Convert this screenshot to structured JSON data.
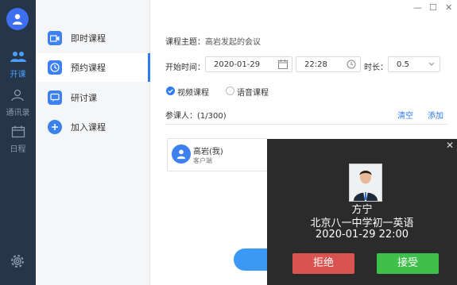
{
  "rail": {
    "items": [
      {
        "label": "开课",
        "icon": "people-icon"
      },
      {
        "label": "通讯录",
        "icon": "contacts-icon"
      },
      {
        "label": "日程",
        "icon": "calendar-icon"
      }
    ]
  },
  "menu": {
    "items": [
      {
        "label": "即时课程",
        "icon": "video-icon"
      },
      {
        "label": "预约课程",
        "icon": "clock-icon"
      },
      {
        "label": "研讨课",
        "icon": "discussion-icon"
      },
      {
        "label": "加入课程",
        "icon": "plus-icon"
      }
    ]
  },
  "form": {
    "subject_label": "课程主题：",
    "subject_value": "高岩发起的会议",
    "start_label": "开始时间：",
    "date_value": "2020-01-29",
    "time_value": "22:28",
    "duration_label": "时长：",
    "duration_value": "0.5",
    "video_label": "视频课程",
    "audio_label": "语音课程",
    "participants_label": "参课人：(1/300)",
    "clear_label": "清空",
    "add_label": "添加"
  },
  "member": {
    "name": "高岩(我)",
    "role": "客户端"
  },
  "popup": {
    "caller_name": "方宁",
    "school": "北京八一中学初一英语",
    "time": "2020-01-29 22:00",
    "reject_label": "拒绝",
    "accept_label": "接受"
  },
  "colors": {
    "rail_bg": "#263547",
    "accent": "#2f7bed",
    "popup_bg": "#2b2b2b",
    "reject": "#d9534f",
    "accept": "#3ec04a"
  }
}
